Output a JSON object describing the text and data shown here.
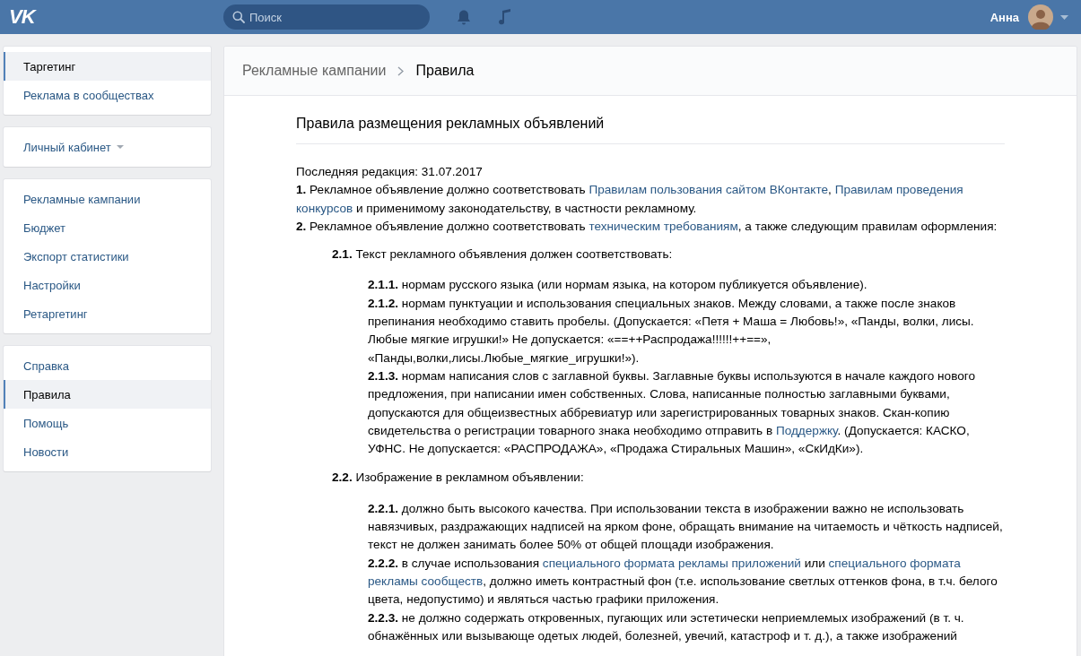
{
  "header": {
    "logo": "VK",
    "search": {
      "placeholder": "Поиск"
    },
    "user": {
      "name": "Анна"
    }
  },
  "sidebar": {
    "groups": [
      {
        "items": [
          {
            "label": "Таргетинг",
            "selected": true
          },
          {
            "label": "Реклама в сообществах",
            "selected": false
          }
        ]
      },
      {
        "items": [
          {
            "label": "Личный кабинет",
            "selected": false,
            "dropdown": true
          }
        ]
      },
      {
        "items": [
          {
            "label": "Рекламные кампании",
            "selected": false
          },
          {
            "label": "Бюджет",
            "selected": false
          },
          {
            "label": "Экспорт статистики",
            "selected": false
          },
          {
            "label": "Настройки",
            "selected": false
          },
          {
            "label": "Ретаргетинг",
            "selected": false
          }
        ]
      },
      {
        "items": [
          {
            "label": "Справка",
            "selected": false
          },
          {
            "label": "Правила",
            "selected": true
          },
          {
            "label": "Помощь",
            "selected": false
          },
          {
            "label": "Новости",
            "selected": false
          }
        ]
      }
    ]
  },
  "breadcrumb": {
    "parent": "Рекламные кампании",
    "current": "Правила"
  },
  "document": {
    "title": "Правила размещения рекламных объявлений",
    "paragraphs": [
      {
        "segments": [
          {
            "kind": "text",
            "text": "Последняя редакция: 31.07.2017"
          }
        ]
      },
      {
        "segments": [
          {
            "kind": "text",
            "text": "**1.** Рекламное объявление должно соответствовать "
          },
          {
            "kind": "link",
            "text": "Правилам пользования сайтом ВКонтакте"
          },
          {
            "kind": "text",
            "text": ", "
          },
          {
            "kind": "link",
            "text": "Правилам проведения"
          },
          {
            "kind": "link",
            "text": "конкурсов",
            "gap": true
          },
          {
            "kind": "text",
            "text": " и применимому законодательству, в частности рекламному."
          }
        ]
      },
      {
        "segments": [
          {
            "kind": "text",
            "text": "**2.** Рекламное объявление должно соответствовать "
          },
          {
            "kind": "link",
            "text": "техническим требованиям"
          },
          {
            "kind": "text",
            "text": ", а также следующим правилам оформления:"
          }
        ],
        "children": [
          {
            "segments": [
              {
                "kind": "text",
                "text": "**2.1.** Текст рекламного объявления должен соответствовать:"
              }
            ],
            "children": [
              {
                "segments": [
                  {
                    "kind": "text",
                    "text": "**2.1.1.** нормам русского языка (или нормам языка, на котором публикуется объявление)."
                  }
                ]
              },
              {
                "segments": [
                  {
                    "kind": "text",
                    "text": "**2.1.2.** нормам пунктуации и использования специальных знаков. Между словами, а также после знаков препинания необходимо ставить пробелы. (Допускается: «Петя + Маша = Любовь!», «Панды, волки, лисы. Любые мягкие игрушки!» Не допускается: «==++Распродажа!!!!!!++==», «Панды,волки,лисы.Любые_мягкие_игрушки!»)."
                  }
                ]
              },
              {
                "segments": [
                  {
                    "kind": "text",
                    "text": "**2.1.3.** нормам написания слов с заглавной буквы. Заглавные буквы используются в начале каждого нового предложения, при написании имен собственных. Слова, написанные полностью заглавными буквами, допускаются для общеизвестных аббревиатур или зарегистрированных товарных знаков. Скан-копию свидетельства о регистрации товарного знака необходимо отправить в "
                  },
                  {
                    "kind": "link",
                    "text": "Поддержку"
                  },
                  {
                    "kind": "text",
                    "text": ". (Допускается: КАСКО, УФНС. Не допускается: «РАСПРОДАЖА», «Продажа Стиральных Машин», «СкИдКи»)."
                  }
                ]
              }
            ]
          },
          {
            "segments": [
              {
                "kind": "text",
                "text": "**2.2.** Изображение в рекламном объявлении:"
              }
            ],
            "children": [
              {
                "segments": [
                  {
                    "kind": "text",
                    "text": "**2.2.1.** должно быть высокого качества. При использовании текста в изображении важно не использовать навязчивых, раздражающих надписей на ярком фоне, обращать внимание на читаемость и чёткость надписей, текст не должен занимать более 50% от общей площади изображения."
                  }
                ]
              },
              {
                "segments": [
                  {
                    "kind": "text",
                    "text": "**2.2.2.** в случае использования "
                  },
                  {
                    "kind": "link",
                    "text": "специального формата рекламы приложений"
                  },
                  {
                    "kind": "text",
                    "text": " или "
                  },
                  {
                    "kind": "link",
                    "text": "специального формата"
                  },
                  {
                    "kind": "link",
                    "text": "рекламы сообществ",
                    "gap": true
                  },
                  {
                    "kind": "text",
                    "text": ", должно иметь контрастный фон (т.е. использование светлых оттенков фона, в т.ч. белого цвета, недопустимо) и являться частью графики приложения."
                  }
                ]
              },
              {
                "segments": [
                  {
                    "kind": "text",
                    "text": "**2.2.3.** не должно содержать откровенных, пугающих или эстетически неприемлемых изображений (в т. ч. обнажённых или вызывающе одетых людей, болезней, увечий, катастроф и т. д.), а также изображений"
                  }
                ]
              }
            ]
          }
        ]
      }
    ]
  }
}
